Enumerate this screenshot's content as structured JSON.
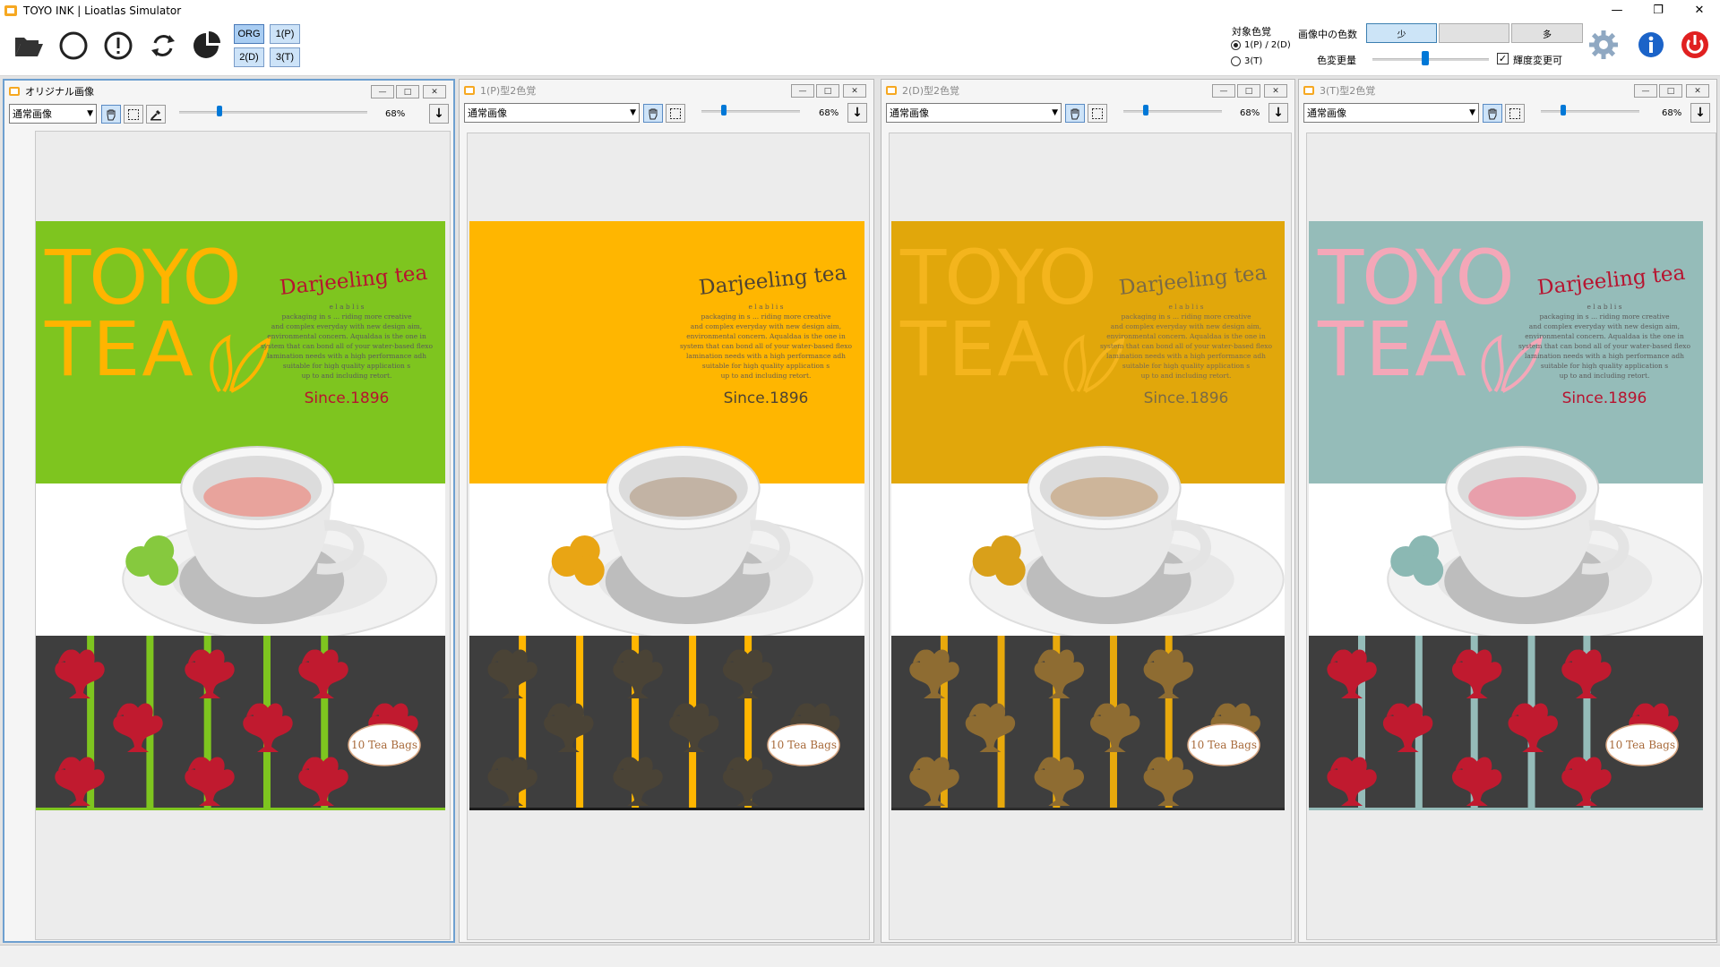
{
  "window": {
    "title": "TOYO INK | Lioatlas Simulator"
  },
  "toolbar": {
    "icons": [
      "folder-open-icon",
      "circle-icon",
      "exclamation-icon",
      "refresh-icon",
      "pie-icon"
    ],
    "modes": [
      {
        "label": "ORG",
        "active": true
      },
      {
        "label": "1(P)",
        "active": false
      },
      {
        "label": "2(D)",
        "active": false
      },
      {
        "label": "3(T)",
        "active": false
      }
    ],
    "target_label": "対象色覚",
    "target_options": [
      {
        "label": "1(P) / 2(D)",
        "checked": true
      },
      {
        "label": "3(T)",
        "checked": false
      }
    ],
    "color_count_label": "画像中の色数",
    "color_count_options": [
      {
        "label": "少",
        "selected": true
      },
      {
        "label": "",
        "selected": false
      },
      {
        "label": "多",
        "selected": false
      }
    ],
    "color_change_label": "色変更量",
    "color_change_level": 0.45,
    "brightness_label": "輝度変更可",
    "brightness_checked": true
  },
  "panels": [
    {
      "title": "オリジナル画像",
      "active": true,
      "view": "通常画像",
      "zoom": "68%",
      "slider_level": 0.2,
      "palette": {
        "band": "#7ec51f",
        "title": "#ffb400",
        "tea_text": "#b7132f",
        "since": "#b7132f",
        "body": "#5b5b5b",
        "stripe": "#7ec51f",
        "motif": "#c01a2f",
        "leaf": "#86c93e",
        "liquid": "#e8a39c",
        "sep": "#7ec51f"
      }
    },
    {
      "title": "1(P)型2色覚",
      "active": false,
      "view": "通常画像",
      "zoom": "68%",
      "slider_level": 0.2,
      "palette": {
        "band": "#ffb600",
        "title": "#ffb600",
        "tea_text": "#4e4333",
        "since": "#4e4333",
        "body": "#6a6050",
        "stripe": "#ffb600",
        "motif": "#4a4336",
        "leaf": "#e9a514",
        "liquid": "#c2b3a4",
        "sep": "#1a1a1a"
      }
    },
    {
      "title": "2(D)型2色覚",
      "active": false,
      "view": "通常画像",
      "zoom": "68%",
      "slider_level": 0.2,
      "palette": {
        "band": "#e1a70b",
        "title": "#f4b51d",
        "tea_text": "#7a6a46",
        "since": "#7a6a46",
        "body": "#7a6c52",
        "stripe": "#e8a90c",
        "motif": "#8e6c32",
        "leaf": "#d9a01a",
        "liquid": "#cdb59a",
        "sep": "#2b2b2b"
      }
    },
    {
      "title": "3(T)型2色覚",
      "active": false,
      "view": "通常画像",
      "zoom": "68%",
      "slider_level": 0.2,
      "palette": {
        "band": "#95bcb9",
        "title": "#f4a7b8",
        "tea_text": "#b7132f",
        "since": "#b7132f",
        "body": "#5b5b5b",
        "stripe": "#95bcb9",
        "motif": "#c01a2f",
        "leaf": "#8bb8b3",
        "liquid": "#e89fab",
        "sep": "#95bcb9"
      }
    }
  ],
  "artwork": {
    "brand_line1": "TOYO",
    "brand_line2": "TEA",
    "tea_name": "Darjeeling tea",
    "body_lines": [
      "e l a b l i s",
      "packaging in s ... riding more creative",
      "and complex everyday with new design aim,",
      "environmental concern. Aqualdaa is the one in",
      "system that can bond all of your water-based flexo",
      "lamination needs with a high performance adh",
      "suitable for high quality application s",
      "up to and including retort."
    ],
    "since": "Since.1896",
    "badge": "10 Tea Bags"
  }
}
